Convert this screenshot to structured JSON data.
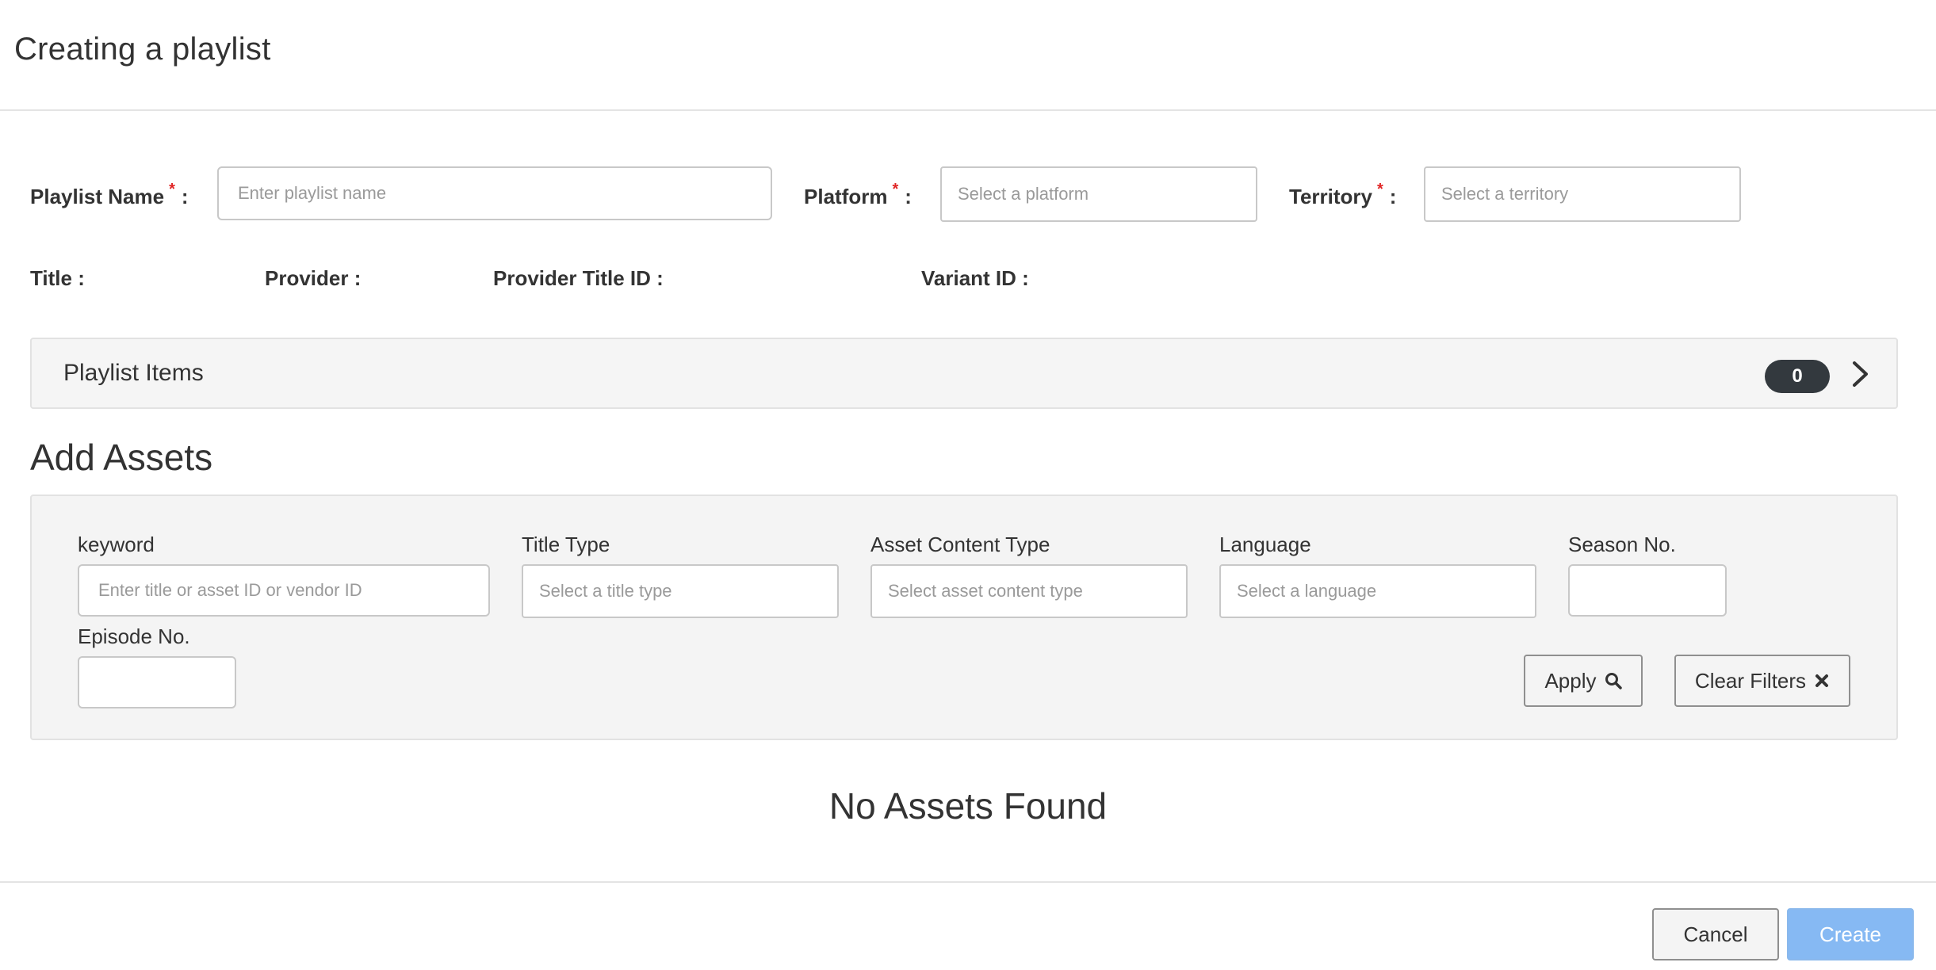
{
  "header": {
    "title": "Creating a playlist"
  },
  "form": {
    "playlist_name": {
      "label": "Playlist Name",
      "required_mark": "*",
      "colon": ":",
      "placeholder": "Enter playlist name",
      "value": ""
    },
    "platform": {
      "label": "Platform",
      "required_mark": "*",
      "colon": ":",
      "placeholder": "Select a platform"
    },
    "territory": {
      "label": "Territory",
      "required_mark": "*",
      "colon": ":",
      "placeholder": "Select a territory"
    }
  },
  "info": {
    "title_label": "Title :",
    "provider_label": "Provider :",
    "provider_title_id_label": "Provider Title ID :",
    "variant_id_label": "Variant ID :"
  },
  "playlist_items": {
    "label": "Playlist Items",
    "count": "0"
  },
  "add_assets": {
    "title": "Add Assets",
    "filters": {
      "keyword": {
        "label": "keyword",
        "placeholder": "Enter title or asset ID or vendor ID",
        "value": ""
      },
      "title_type": {
        "label": "Title Type",
        "placeholder": "Select a title type"
      },
      "asset_content_type": {
        "label": "Asset Content Type",
        "placeholder": "Select asset content type"
      },
      "language": {
        "label": "Language",
        "placeholder": "Select a language"
      },
      "season_no": {
        "label": "Season No.",
        "value": ""
      },
      "episode_no": {
        "label": "Episode No.",
        "value": ""
      }
    },
    "apply_label": "Apply",
    "clear_label": "Clear Filters",
    "empty_message": "No Assets Found"
  },
  "footer": {
    "cancel_label": "Cancel",
    "create_label": "Create"
  },
  "colors": {
    "required": "#e02424",
    "badge_bg": "#33393e",
    "create_button": "#86b9f3",
    "panel_bg": "#f4f4f4"
  },
  "icons": {
    "items_bar": "chevron-right-icon",
    "apply": "search-icon",
    "clear": "times-icon"
  }
}
